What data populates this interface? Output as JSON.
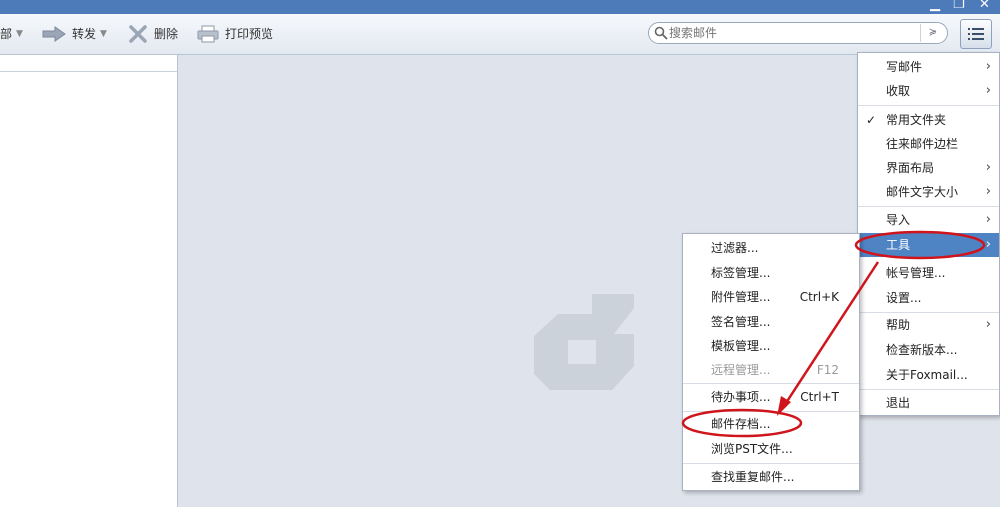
{
  "toolbar": {
    "delete_all_label": "部",
    "forward_label": "转发",
    "delete_label": "删除",
    "print_preview_label": "打印预览"
  },
  "search": {
    "placeholder": "搜索邮件"
  },
  "main_menu": {
    "items": [
      {
        "label": "写邮件"
      },
      {
        "label": "收取"
      },
      {
        "label": "常用文件夹"
      },
      {
        "label": "往来邮件边栏"
      },
      {
        "label": "界面布局"
      },
      {
        "label": "邮件文字大小"
      },
      {
        "label": "导入"
      },
      {
        "label": "工具"
      },
      {
        "label": "帐号管理..."
      },
      {
        "label": "设置..."
      },
      {
        "label": "帮助"
      },
      {
        "label": "检查新版本..."
      },
      {
        "label": "关于Foxmail..."
      },
      {
        "label": "退出"
      }
    ]
  },
  "tools_menu": {
    "items": [
      {
        "label": "过滤器..."
      },
      {
        "label": "标签管理..."
      },
      {
        "label": "附件管理...",
        "shortcut": "Ctrl+K"
      },
      {
        "label": "签名管理..."
      },
      {
        "label": "模板管理..."
      },
      {
        "label": "远程管理...",
        "shortcut": "F12"
      },
      {
        "label": "待办事项...",
        "shortcut": "Ctrl+T"
      },
      {
        "label": "邮件存档..."
      },
      {
        "label": "浏览PST文件..."
      },
      {
        "label": "查找重复邮件..."
      }
    ]
  },
  "colors": {
    "accent": "#4f84c4",
    "annotation": "#d0141b",
    "titlebar": "#4d7ab9"
  },
  "icons": [
    "minimize-icon",
    "restore-icon",
    "close-icon",
    "forward-icon",
    "delete-icon",
    "print-icon",
    "search-icon",
    "chevron-down-icon",
    "menu-list-icon",
    "check-icon",
    "chevron-right-icon",
    "foxmail-logo-icon"
  ]
}
